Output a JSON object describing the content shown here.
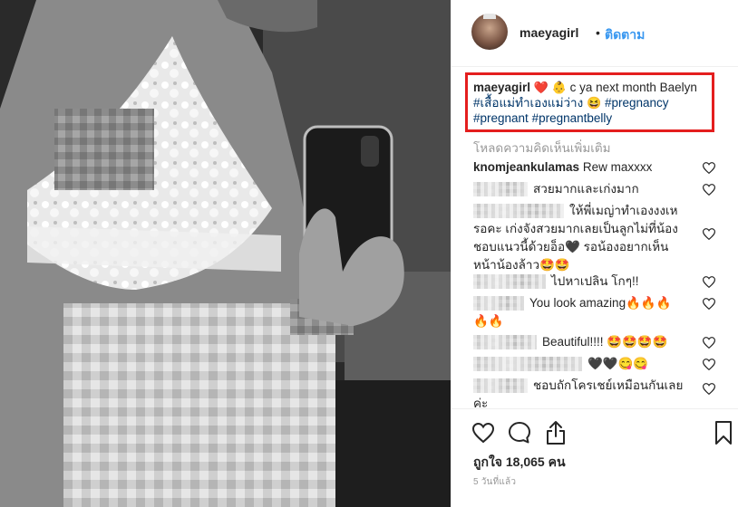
{
  "header": {
    "username": "maeyagirl",
    "separator": "•",
    "follow_label": "ติดตาม"
  },
  "caption": {
    "username": "maeyagirl",
    "emoji": "❤️ 👶",
    "text": " c ya next month Baelyn ",
    "tag_thai": "#เสื้อแม่ทำเองแม่ว่าง",
    "laugh_emoji": "😆",
    "tag_pregnancy": "#pregnancy",
    "tag_pregnant": "#pregnant",
    "tag_pregnantbelly": "#pregnantbelly"
  },
  "load_more_label": "โหลดความคิดเห็นเพิ่มเติม",
  "comments": [
    {
      "username": "knomjeankulamas",
      "text": "Rew maxxxx"
    },
    {
      "username": "",
      "text": "สวยมากและเก่งมาก"
    },
    {
      "username": "",
      "text": "ให้พี่เมญ่าทำเองงงเหรอคะ เก่งจังสวยมากเลยเป็นลูกไม่ที่น้องชอบแนวนี้ด้วยอ็อ🖤 รอน้องอยากเห็นหน้าน้องล้าว🤩🤩"
    },
    {
      "username": "",
      "text": "ไปหาเปลิน โกๆ!!"
    },
    {
      "username": "",
      "text": "You look amazing🔥🔥🔥🔥🔥"
    },
    {
      "username": "",
      "text": "Beautiful!!!! 🤩🤩🤩🤩"
    },
    {
      "username": "",
      "text": "🖤🖤😋😋"
    },
    {
      "username": "",
      "text": "ชอบถักโครเชย์เหมือนกันเลยค่ะ"
    }
  ],
  "likes_label": "ถูกใจ 18,065 คน",
  "time_label": "5 วันที่แล้ว",
  "icons": {
    "like": "heart-outline-icon",
    "comment": "speech-bubble-icon",
    "share": "share-icon",
    "save": "bookmark-icon",
    "comment_like": "small-heart-icon"
  },
  "colors": {
    "follow": "#3897f0",
    "hashtag": "#003569",
    "highlight_box": "#e41e1e",
    "muted": "#999999"
  }
}
